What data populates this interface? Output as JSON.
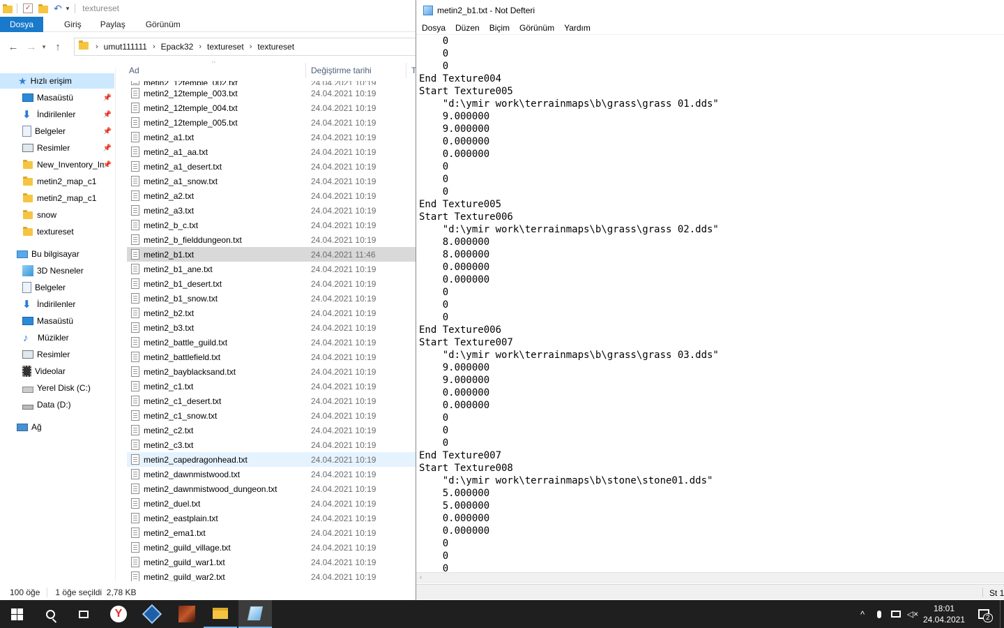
{
  "explorer": {
    "qat_title": "textureset",
    "ribbon_tabs": [
      "Dosya",
      "Giriş",
      "Paylaş",
      "Görünüm"
    ],
    "breadcrumb": [
      "umut111111",
      "Epack32",
      "textureset",
      "textureset"
    ],
    "nav": {
      "quick_access": "Hızlı erişim",
      "quick_items": [
        "Masaüstü",
        "İndirilenler",
        "Belgeler",
        "Resimler",
        "New_Inventory_Im",
        "metin2_map_c1",
        "metin2_map_c1",
        "snow",
        "textureset"
      ],
      "this_pc": "Bu bilgisayar",
      "pc_items": [
        "3D Nesneler",
        "Belgeler",
        "İndirilenler",
        "Masaüstü",
        "Müzikler",
        "Resimler",
        "Videolar",
        "Yerel Disk (C:)",
        "Data (D:)"
      ],
      "network": "Ağ"
    },
    "columns": {
      "name": "Ad",
      "date": "Değiştirme tarihi",
      "type": "T"
    },
    "partial_top": {
      "name": "metin2_12temple_002.txt",
      "date": "24.04.2021 10:19"
    },
    "files": [
      {
        "name": "metin2_12temple_003.txt",
        "date": "24.04.2021 10:19"
      },
      {
        "name": "metin2_12temple_004.txt",
        "date": "24.04.2021 10:19"
      },
      {
        "name": "metin2_12temple_005.txt",
        "date": "24.04.2021 10:19"
      },
      {
        "name": "metin2_a1.txt",
        "date": "24.04.2021 10:19"
      },
      {
        "name": "metin2_a1_aa.txt",
        "date": "24.04.2021 10:19"
      },
      {
        "name": "metin2_a1_desert.txt",
        "date": "24.04.2021 10:19"
      },
      {
        "name": "metin2_a1_snow.txt",
        "date": "24.04.2021 10:19"
      },
      {
        "name": "metin2_a2.txt",
        "date": "24.04.2021 10:19"
      },
      {
        "name": "metin2_a3.txt",
        "date": "24.04.2021 10:19"
      },
      {
        "name": "metin2_b_c.txt",
        "date": "24.04.2021 10:19"
      },
      {
        "name": "metin2_b_fielddungeon.txt",
        "date": "24.04.2021 10:19"
      },
      {
        "name": "metin2_b1.txt",
        "date": "24.04.2021 11:46"
      },
      {
        "name": "metin2_b1_ane.txt",
        "date": "24.04.2021 10:19"
      },
      {
        "name": "metin2_b1_desert.txt",
        "date": "24.04.2021 10:19"
      },
      {
        "name": "metin2_b1_snow.txt",
        "date": "24.04.2021 10:19"
      },
      {
        "name": "metin2_b2.txt",
        "date": "24.04.2021 10:19"
      },
      {
        "name": "metin2_b3.txt",
        "date": "24.04.2021 10:19"
      },
      {
        "name": "metin2_battle_guild.txt",
        "date": "24.04.2021 10:19"
      },
      {
        "name": "metin2_battlefield.txt",
        "date": "24.04.2021 10:19"
      },
      {
        "name": "metin2_bayblacksand.txt",
        "date": "24.04.2021 10:19"
      },
      {
        "name": "metin2_c1.txt",
        "date": "24.04.2021 10:19"
      },
      {
        "name": "metin2_c1_desert.txt",
        "date": "24.04.2021 10:19"
      },
      {
        "name": "metin2_c1_snow.txt",
        "date": "24.04.2021 10:19"
      },
      {
        "name": "metin2_c2.txt",
        "date": "24.04.2021 10:19"
      },
      {
        "name": "metin2_c3.txt",
        "date": "24.04.2021 10:19"
      },
      {
        "name": "metin2_capedragonhead.txt",
        "date": "24.04.2021 10:19"
      },
      {
        "name": "metin2_dawnmistwood.txt",
        "date": "24.04.2021 10:19"
      },
      {
        "name": "metin2_dawnmistwood_dungeon.txt",
        "date": "24.04.2021 10:19"
      },
      {
        "name": "metin2_duel.txt",
        "date": "24.04.2021 10:19"
      },
      {
        "name": "metin2_eastplain.txt",
        "date": "24.04.2021 10:19"
      },
      {
        "name": "metin2_ema1.txt",
        "date": "24.04.2021 10:19"
      },
      {
        "name": "metin2_guild_village.txt",
        "date": "24.04.2021 10:19"
      },
      {
        "name": "metin2_guild_war1.txt",
        "date": "24.04.2021 10:19"
      },
      {
        "name": "metin2_guild_war2.txt",
        "date": "24.04.2021 10:19"
      }
    ],
    "selected_file": "metin2_b1.txt",
    "hovered_file": "metin2_capedragonhead.txt",
    "status": {
      "count": "100 öğe",
      "selection": "1 öğe seçildi  2,78 KB"
    }
  },
  "notepad": {
    "title": "metin2_b1.txt - Not Defteri",
    "menu": [
      "Dosya",
      "Düzen",
      "Biçim",
      "Görünüm",
      "Yardım"
    ],
    "lines": [
      "    0",
      "    0",
      "    0",
      "End Texture004",
      "Start Texture005",
      "    \"d:\\ymir work\\terrainmaps\\b\\grass\\grass 01.dds\"",
      "    9.000000",
      "    9.000000",
      "    0.000000",
      "    0.000000",
      "    0",
      "    0",
      "    0",
      "End Texture005",
      "Start Texture006",
      "    \"d:\\ymir work\\terrainmaps\\b\\grass\\grass 02.dds\"",
      "    8.000000",
      "    8.000000",
      "    0.000000",
      "    0.000000",
      "    0",
      "    0",
      "    0",
      "End Texture006",
      "Start Texture007",
      "    \"d:\\ymir work\\terrainmaps\\b\\grass\\grass 03.dds\"",
      "    9.000000",
      "    9.000000",
      "    0.000000",
      "    0.000000",
      "    0",
      "    0",
      "    0",
      "End Texture007",
      "Start Texture008",
      "    \"d:\\ymir work\\terrainmaps\\b\\stone\\stone01.dds\"",
      "    5.000000",
      "    5.000000",
      "    0.000000",
      "    0.000000",
      "    0",
      "    0",
      "    0"
    ],
    "status_right": "St 1"
  },
  "taskbar": {
    "time": "18:01",
    "date": "24.04.2021",
    "notification_count": "2"
  },
  "colors": {
    "ribbon_active": "#1979ca",
    "selection": "#d9d9d9",
    "nav_selected": "#cce8ff",
    "taskbar": "#1f1f1f"
  }
}
